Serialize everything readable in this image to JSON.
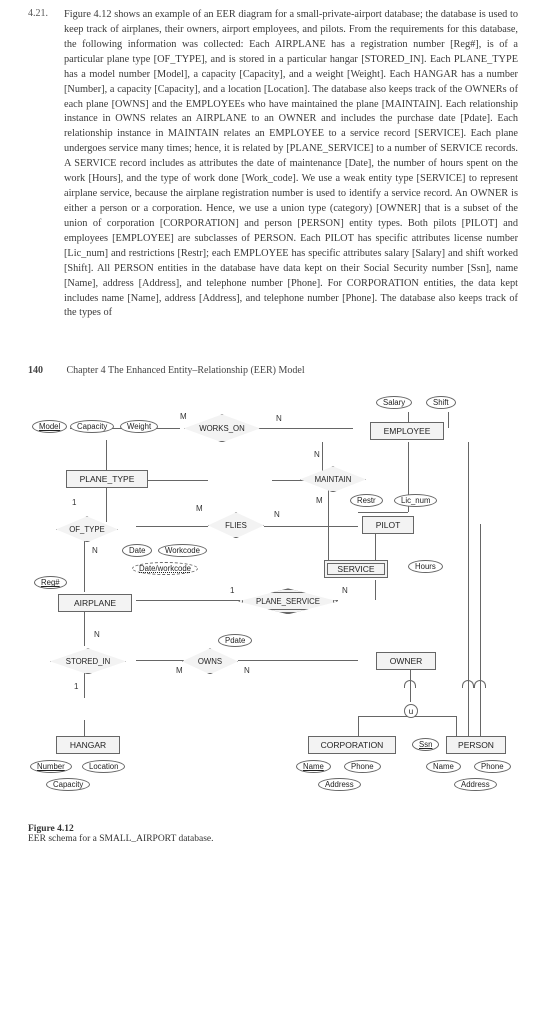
{
  "question": {
    "number": "4.21.",
    "text": "Figure 4.12 shows an example of an EER diagram for a small-private-airport database; the database is used to keep track of airplanes, their owners, airport employees, and pilots. From the requirements for this database, the following information was collected: Each AIRPLANE has a registration number [Reg#], is of a particular plane type [OF_TYPE], and is stored in a particular hangar [STORED_IN]. Each PLANE_TYPE has a model number [Model], a capacity [Capacity], and a weight [Weight]. Each HANGAR has a number [Number], a capacity [Capacity], and a location [Location]. The database also keeps track of the OWNERs of each plane [OWNS] and the EMPLOYEEs who have maintained the plane [MAINTAIN]. Each relationship instance in OWNS relates an AIRPLANE to an OWNER and includes the purchase date [Pdate]. Each relationship instance in MAINTAIN relates an EMPLOYEE to a service record [SERVICE]. Each plane undergoes service many times; hence, it is related by [PLANE_SERVICE] to a number of SERVICE records. A SERVICE record includes as attributes the date of maintenance [Date], the number of hours spent on the work [Hours], and the type of work done [Work_code]. We use a weak entity type [SERVICE] to represent airplane service, because the airplane registration number is used to identify a service record. An OWNER is either a person or a corporation. Hence, we use a union type (category) [OWNER] that is a subset of the union of corporation [CORPORATION] and person [PERSON] entity types. Both pilots [PILOT] and employees [EMPLOYEE] are subclasses of PERSON. Each PILOT has specific attributes license number [Lic_num] and restrictions [Restr]; each EMPLOYEE has specific attributes salary [Salary] and shift worked [Shift]. All PERSON entities in the database have data kept on their Social Security number [Ssn], name [Name], address [Address], and telephone number [Phone]. For CORPORATION entities, the data kept includes name [Name], address [Address], and telephone number [Phone]. The database also keeps track of the types of"
  },
  "chapter": {
    "page": "140",
    "title": "Chapter 4 The Enhanced Entity–Relationship (EER) Model"
  },
  "diagram": {
    "entities": {
      "plane_type": "PLANE_TYPE",
      "airplane": "AIRPLANE",
      "hangar": "HANGAR",
      "employee": "EMPLOYEE",
      "pilot": "PILOT",
      "service": "SERVICE",
      "owner": "OWNER",
      "corporation": "CORPORATION",
      "person": "PERSON"
    },
    "relationships": {
      "works_on": "WORKS_ON",
      "maintain": "MAINTAIN",
      "flies": "FLIES",
      "of_type": "OF_TYPE",
      "plane_service": "PLANE_SERVICE",
      "stored_in": "STORED_IN",
      "owns": "OWNS"
    },
    "attributes": {
      "model": "Model",
      "capacity_pt": "Capacity",
      "weight": "Weight",
      "reg": "Reg#",
      "date": "Date",
      "workcode": "Workcode",
      "dateworkcode": "Date/workcode",
      "salary": "Salary",
      "shift": "Shift",
      "restr": "Restr",
      "lic_num": "Lic_num",
      "hours": "Hours",
      "pdate": "Pdate",
      "number": "Number",
      "location": "Location",
      "capacity_h": "Capacity",
      "name_c": "Name",
      "phone_c": "Phone",
      "address_c": "Address",
      "ssn": "Ssn",
      "name_p": "Name",
      "phone_p": "Phone",
      "address_p": "Address"
    },
    "cards": {
      "M1": "M",
      "N1": "N",
      "M2": "M",
      "N2": "N",
      "N3": "N",
      "one1": "1",
      "M3": "M",
      "N4": "N",
      "N5": "N",
      "one2": "1",
      "one3": "1",
      "N6": "N",
      "M4": "M"
    },
    "union": "u"
  },
  "caption": {
    "fig": "Figure 4.12",
    "desc": "EER schema for a SMALL_AIRPORT database."
  }
}
